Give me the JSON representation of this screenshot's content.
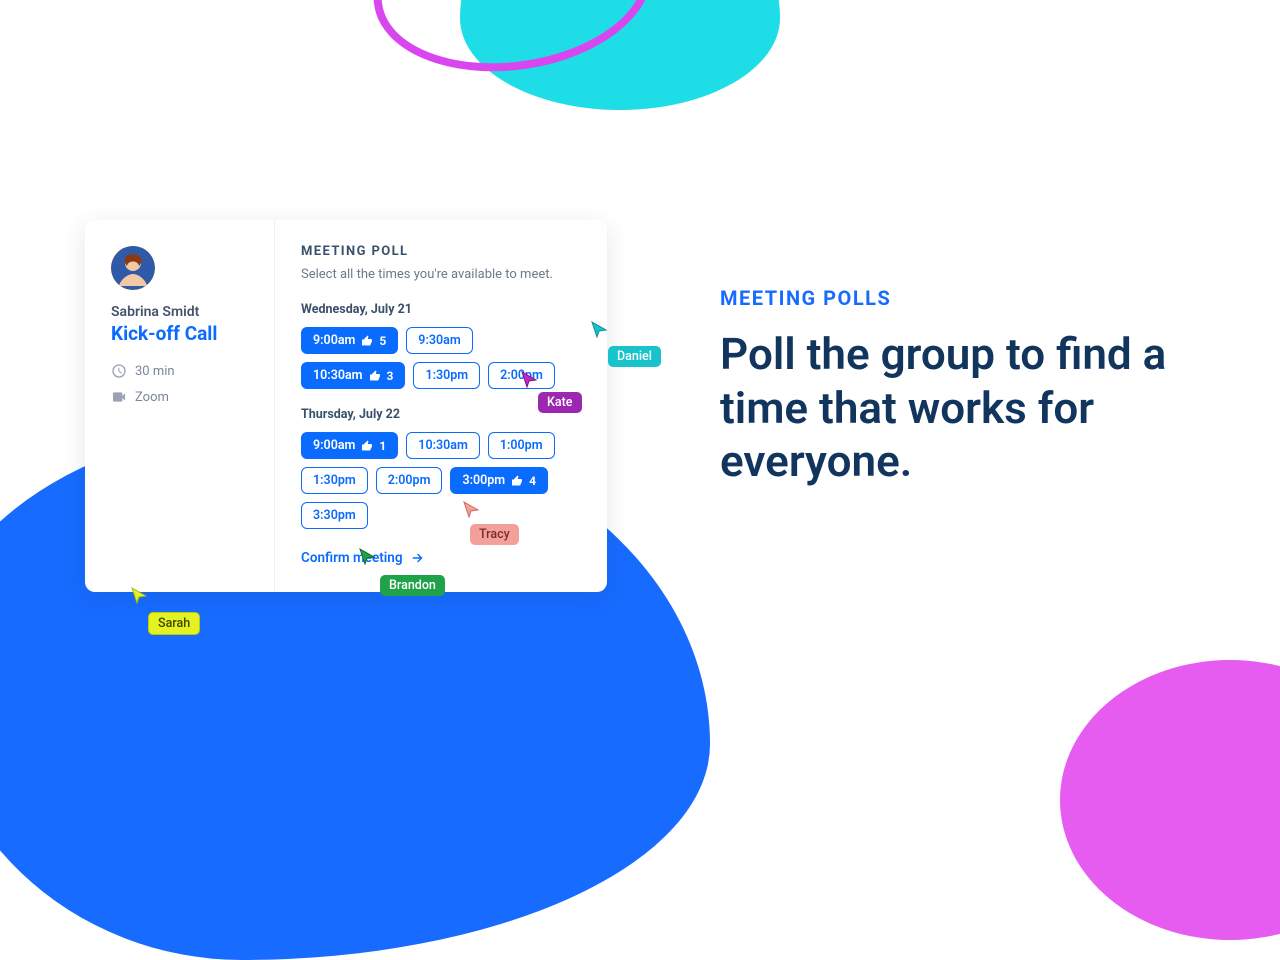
{
  "colors": {
    "primary": "#176bff",
    "accent_cyan": "#1edde6",
    "accent_magenta": "#e65cf0",
    "navy": "#12355e"
  },
  "card": {
    "host": {
      "name": "Sabrina Smidt",
      "meeting_title": "Kick-off Call"
    },
    "meta": {
      "duration": "30 min",
      "platform": "Zoom"
    },
    "poll": {
      "heading": "MEETING POLL",
      "subheading": "Select all the times you're available to meet.",
      "days": [
        {
          "label": "Wednesday, July 21",
          "slots": [
            {
              "time": "9:00am",
              "selected": true,
              "votes": 5
            },
            {
              "time": "9:30am",
              "selected": false,
              "votes": null
            },
            {
              "time": "10:30am",
              "selected": true,
              "votes": 3
            },
            {
              "time": "1:30pm",
              "selected": false,
              "votes": null
            },
            {
              "time": "2:00pm",
              "selected": false,
              "votes": null
            }
          ]
        },
        {
          "label": "Thursday, July 22",
          "slots": [
            {
              "time": "9:00am",
              "selected": true,
              "votes": 1
            },
            {
              "time": "10:30am",
              "selected": false,
              "votes": null
            },
            {
              "time": "1:00pm",
              "selected": false,
              "votes": null
            },
            {
              "time": "1:30pm",
              "selected": false,
              "votes": null
            },
            {
              "time": "2:00pm",
              "selected": false,
              "votes": null
            },
            {
              "time": "3:00pm",
              "selected": true,
              "votes": 4
            },
            {
              "time": "3:30pm",
              "selected": false,
              "votes": null
            }
          ]
        }
      ],
      "confirm_label": "Confirm meeting"
    }
  },
  "cursors": {
    "daniel": {
      "label": "Daniel",
      "color": "#19c3cc"
    },
    "kate": {
      "label": "Kate",
      "color": "#c028c8"
    },
    "tracy": {
      "label": "Tracy",
      "color": "#f4a09a"
    },
    "brandon": {
      "label": "Brandon",
      "color": "#1fa24a"
    },
    "sarah": {
      "label": "Sarah",
      "color": "#e4f222"
    }
  },
  "headline": {
    "eyebrow": "MEETING POLLS",
    "text": "Poll the group to find a time that works for everyone."
  }
}
